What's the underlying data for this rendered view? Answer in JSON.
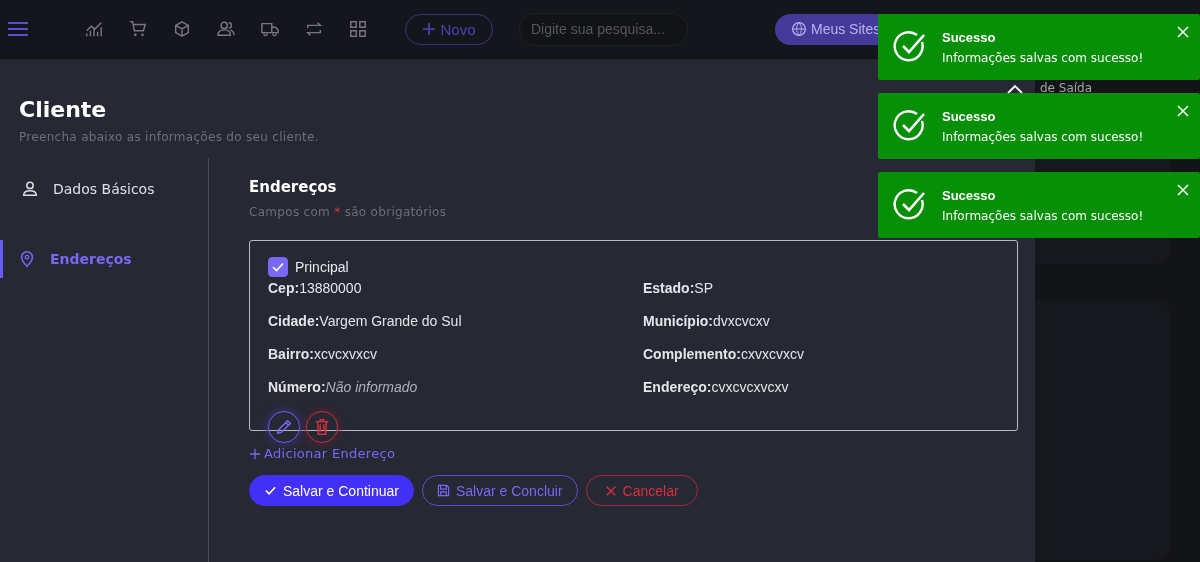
{
  "topbar": {
    "icons": [
      {
        "kind": "chart"
      },
      {
        "kind": "cart"
      },
      {
        "kind": "box"
      },
      {
        "kind": "users"
      },
      {
        "kind": "truck"
      },
      {
        "kind": "swap"
      },
      {
        "kind": "grid"
      }
    ],
    "new_button": "Novo",
    "search": {
      "placeholder": "Digite sua pesquisa..."
    },
    "sites_button": "Meus Sites"
  },
  "backdrop": {
    "label": "de Saída"
  },
  "modal": {
    "title": "Cliente",
    "subtitle": "Preencha abaixo as informações do seu cliente.",
    "sidebar": [
      {
        "label": "Dados Básicos",
        "kind": "person",
        "selected": false
      },
      {
        "label": "Endereços",
        "kind": "pin",
        "selected": true
      }
    ],
    "section_title": "Endereços",
    "required_note": "Campos com * são obrigatórios",
    "address": {
      "principal": {
        "label": "Principal",
        "checked": true
      },
      "fields": [
        {
          "label": "Cep:",
          "value": "13880000",
          "italic": false
        },
        {
          "label": "Estado:",
          "value": "SP",
          "italic": false
        },
        {
          "label": "Cidade:",
          "value": "Vargem Grande do Sul",
          "italic": false
        },
        {
          "label": "Município:",
          "value": "dvxcvcxv",
          "italic": false
        },
        {
          "label": "Bairro:",
          "value": "xcvcxvxcv",
          "italic": false
        },
        {
          "label": "Complemento:",
          "value": "cxvxcvxcv",
          "italic": false
        },
        {
          "label": "Número:",
          "value": "Não informado",
          "italic": true
        },
        {
          "label": "Endereço:",
          "value": "cvxcvcxvcxv",
          "italic": false
        }
      ]
    },
    "add_link": "Adicionar Endereço",
    "buttons": [
      {
        "label": "Salvar e Continuar",
        "kind": "primary"
      },
      {
        "label": "Salvar e Concluir",
        "kind": "outline"
      },
      {
        "label": "Cancelar",
        "kind": "danger"
      }
    ]
  },
  "toasts": [
    {
      "title": "Sucesso",
      "message": "Informações salvas com sucesso!"
    },
    {
      "title": "Sucesso",
      "message": "Informações salvas com sucesso!"
    },
    {
      "title": "Sucesso",
      "message": "Informações salvas com sucesso!"
    }
  ]
}
